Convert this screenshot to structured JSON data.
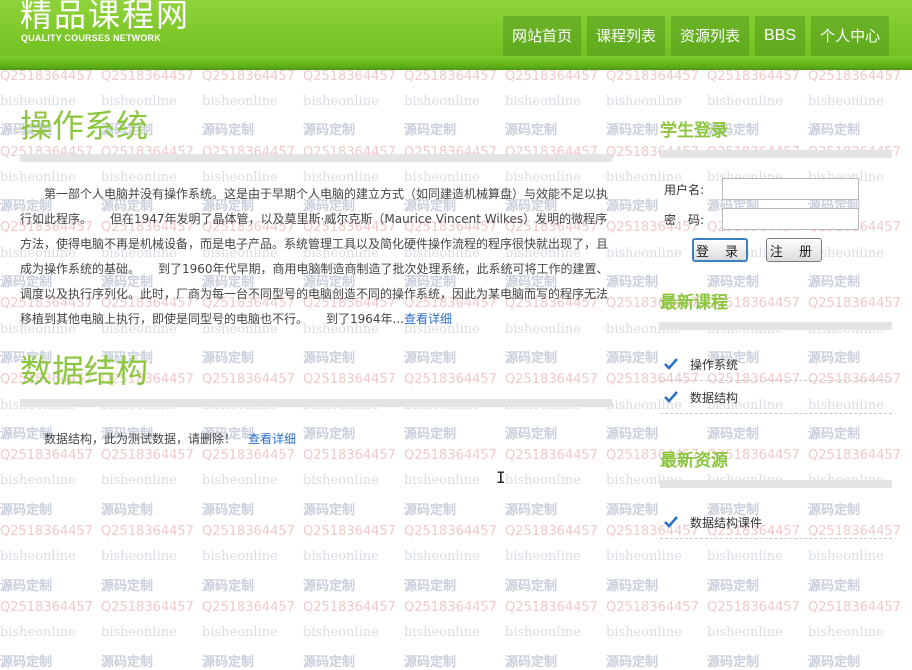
{
  "watermark": {
    "site": "bisheonline",
    "label": "源码定制",
    "qq": "Q2518364457"
  },
  "header": {
    "logo_title": "精品课程网",
    "logo_subtitle": "QUALITY COURSES NETWORK",
    "nav": [
      {
        "label": "网站首页"
      },
      {
        "label": "课程列表"
      },
      {
        "label": "资源列表"
      },
      {
        "label": "BBS"
      },
      {
        "label": "个人中心"
      }
    ]
  },
  "main": {
    "articles": [
      {
        "title": "操作系统",
        "text": "第一部个人电脑并没有操作系统。这是由于早期个人电脑的建立方式（如同建造机械算盘）与效能不足以执行如此程序。　　但在1947年发明了晶体管，以及莫里斯·威尔克斯（Maurice Vincent Wilkes）发明的微程序方法，使得电脑不再是机械设备，而是电子产品。系统管理工具以及简化硬件操作流程的程序很快就出现了，且成为操作系统的基础。　　到了1960年代早期，商用电脑制造商制造了批次处理系统，此系统可将工作的建置、调度以及执行序列化。此时，厂商为每一台不同型号的电脑创造不同的操作系统，因此为某电脑而写的程序无法移植到其他电脑上执行，即使是同型号的电脑也不行。　　到了1964年...",
        "more": "查看详细"
      },
      {
        "title": "数据结构",
        "text": "数据结构，此为测试数据，请删除！",
        "more": "查看详细"
      }
    ]
  },
  "sidebar": {
    "login": {
      "title": "学生登录",
      "username_label": "用户名:",
      "password_label": "密　码:",
      "username_value": "",
      "password_value": "",
      "login_button": "登 录",
      "register_button": "注 册"
    },
    "latest_courses": {
      "title": "最新课程",
      "items": [
        {
          "label": "操作系统"
        },
        {
          "label": "数据结构"
        }
      ]
    },
    "latest_resources": {
      "title": "最新资源",
      "items": [
        {
          "label": "数据结构课件"
        }
      ]
    }
  },
  "colors": {
    "header_green": "#7ccc2a",
    "title_green": "#8cc63f",
    "link_blue": "#2a6fc9"
  },
  "icons": {
    "list_item": "check-icon",
    "pointer": "text-cursor-icon"
  }
}
